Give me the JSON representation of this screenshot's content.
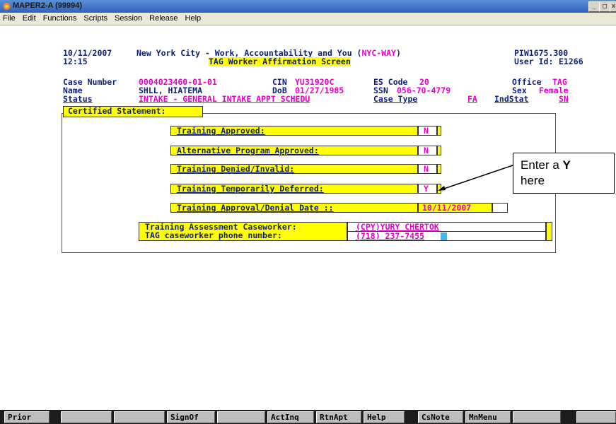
{
  "window": {
    "title": "MAPER2-A (99994)",
    "buttons": [
      "_",
      "□",
      "x"
    ]
  },
  "menu": [
    "File",
    "Edit",
    "Functions",
    "Scripts",
    "Session",
    "Release",
    "Help"
  ],
  "header": {
    "date": "10/11/2007",
    "time": "12:15",
    "system_title_prefix": "New York City - Work, Accountability and You (",
    "system_code": "NYC-WAY",
    "system_title_suffix": ")",
    "screen_id": "PIW1675.300",
    "screen_title": "TAG Worker Affirmation Screen",
    "user_label": "User Id:",
    "user_id": "E1266"
  },
  "case": {
    "case_number_label": "Case Number",
    "case_number": "0004023460-01-01",
    "cin_label": "CIN",
    "cin": "YU31920C",
    "es_code_label": "ES Code",
    "es_code": "20",
    "office_label": "Office",
    "office": "TAG",
    "name_label": "Name",
    "name": "SHLL, HIATEMA",
    "dob_label": "DoB",
    "dob": "01/27/1985",
    "ssn_label": "SSN",
    "ssn": "056-70-4779",
    "sex_label": "Sex",
    "sex": "Female",
    "status_label": "Status",
    "status": "INTAKE - GENERAL INTAKE APPT SCHEDU",
    "case_type_label": "Case Type",
    "case_type": "FA",
    "indstat_label": "IndStat",
    "indstat": "SN"
  },
  "certified": {
    "header": "Certified Statement:",
    "training_approved_label": "Training Approved:",
    "training_approved_value": "N",
    "alt_program_label": "Alternative Program Approved:",
    "alt_program_value": "N",
    "training_denied_label": "Training Denied/Invalid:",
    "training_denied_value": "N",
    "training_deferred_label": "Training Temporarily Deferred:",
    "training_deferred_value": "Y",
    "approval_date_label": "Training Approval/Denial Date ::",
    "approval_date_value": "10/11/2007",
    "caseworker_label": "Training Assessment Caseworker:",
    "caseworker_value": "(CPY)YURY CHERTOK",
    "phone_label": "TAG caseworker phone number:",
    "phone_value": "(718) 237-7455"
  },
  "callout": {
    "text_before": "Enter a ",
    "text_bold": "Y",
    "text_after": "here"
  },
  "fkeys": [
    "Prior",
    "",
    "",
    "SignOf",
    "",
    "ActInq",
    "RtnApt",
    "Help",
    "CsNote",
    "MnMenu",
    "",
    ""
  ],
  "colors": {
    "navy": "#0e1f7a",
    "magenta": "#e800c8",
    "field_yellow": "#ffff00",
    "cursor_cyan": "#3fb8f0"
  }
}
